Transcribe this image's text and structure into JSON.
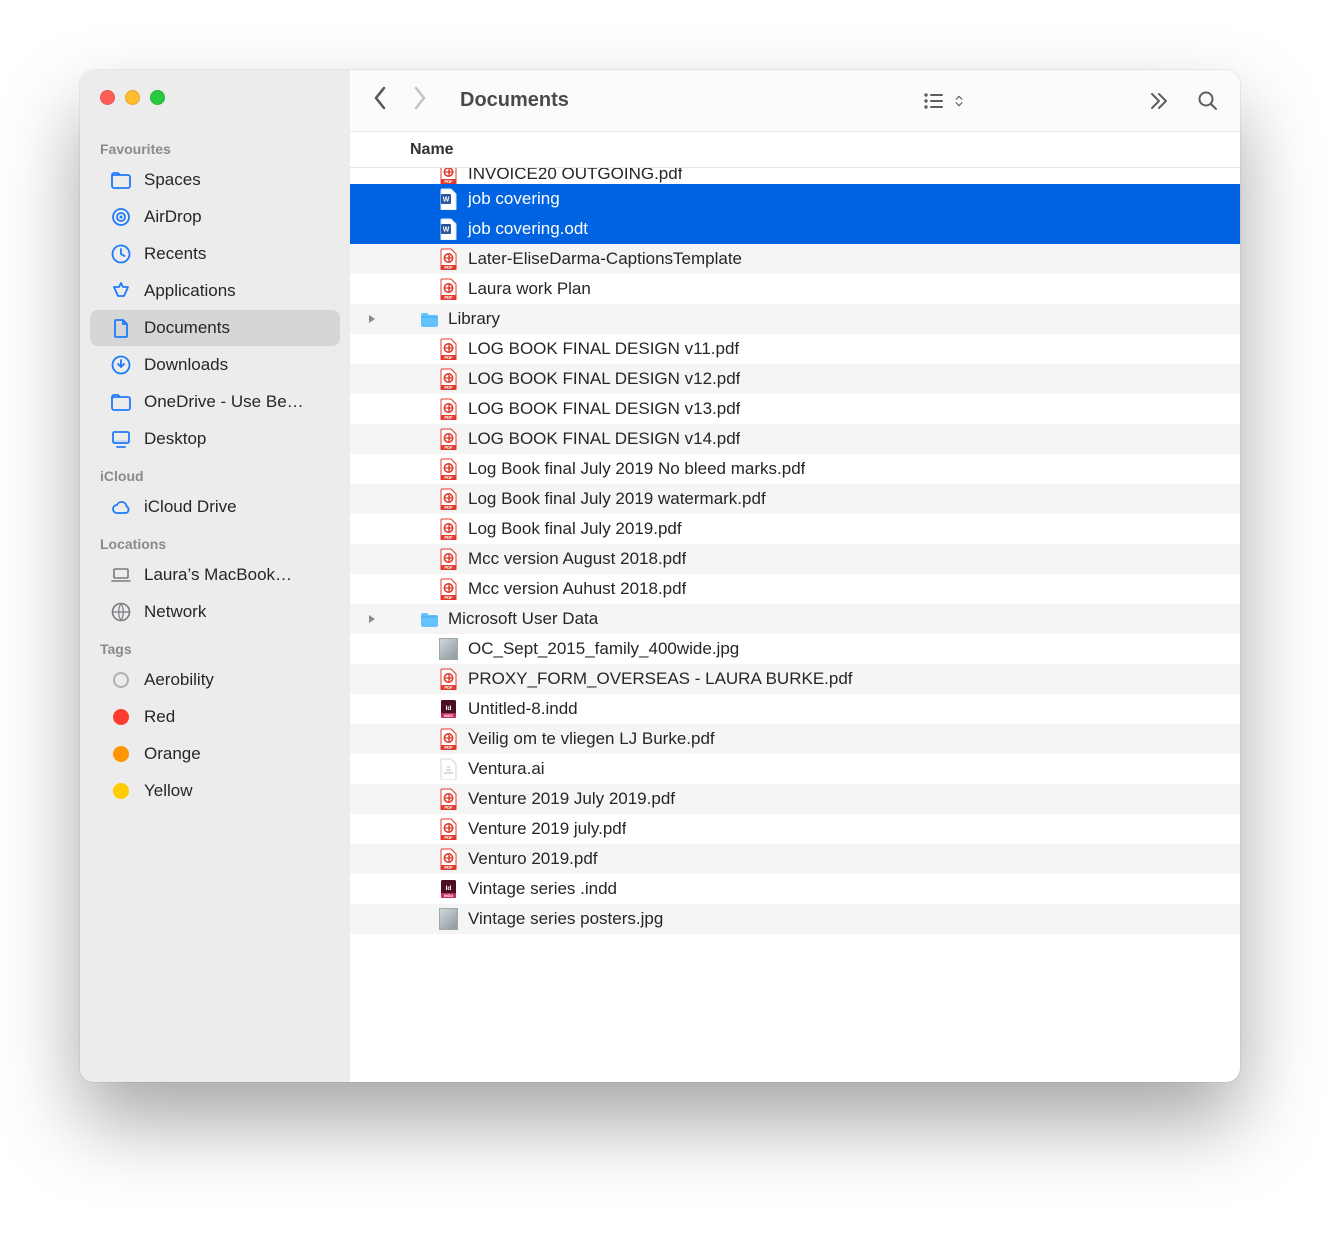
{
  "window": {
    "title": "Documents"
  },
  "columns": {
    "name": "Name"
  },
  "traffic": {
    "close": "close",
    "minimize": "minimize",
    "zoom": "zoom"
  },
  "sidebar": {
    "sections": [
      {
        "label": "Favourites",
        "items": [
          {
            "label": "Spaces",
            "icon": "folder",
            "active": false
          },
          {
            "label": "AirDrop",
            "icon": "airdrop",
            "active": false
          },
          {
            "label": "Recents",
            "icon": "clock",
            "active": false
          },
          {
            "label": "Applications",
            "icon": "appstore",
            "active": false
          },
          {
            "label": "Documents",
            "icon": "doc",
            "active": true
          },
          {
            "label": "Downloads",
            "icon": "download",
            "active": false
          },
          {
            "label": "OneDrive - Use Be…",
            "icon": "folder",
            "active": false
          },
          {
            "label": "Desktop",
            "icon": "desktop",
            "active": false
          }
        ]
      },
      {
        "label": "iCloud",
        "items": [
          {
            "label": "iCloud Drive",
            "icon": "cloud",
            "active": false
          }
        ]
      },
      {
        "label": "Locations",
        "items": [
          {
            "label": "Laura’s MacBook…",
            "icon": "laptop",
            "active": false
          },
          {
            "label": "Network",
            "icon": "globe",
            "active": false
          }
        ]
      },
      {
        "label": "Tags",
        "items": [
          {
            "label": "Aerobility",
            "icon": "tag",
            "tag_color": "outline"
          },
          {
            "label": "Red",
            "icon": "tag",
            "tag_color": "#ff3b30"
          },
          {
            "label": "Orange",
            "icon": "tag",
            "tag_color": "#ff9500"
          },
          {
            "label": "Yellow",
            "icon": "tag",
            "tag_color": "#ffcc00"
          }
        ]
      }
    ]
  },
  "files": [
    {
      "name": "INVOICE20 OUTGOING.pdf",
      "type": "pdf",
      "selected": false,
      "folder": false,
      "cut": true
    },
    {
      "name": "job covering",
      "type": "word",
      "selected": true,
      "folder": false
    },
    {
      "name": "job covering.odt",
      "type": "word",
      "selected": true,
      "folder": false
    },
    {
      "name": "Later-EliseDarma-CaptionsTemplate",
      "type": "pdf",
      "selected": false,
      "folder": false
    },
    {
      "name": "Laura work Plan",
      "type": "pdf",
      "selected": false,
      "folder": false
    },
    {
      "name": "Library",
      "type": "folder",
      "selected": false,
      "folder": true
    },
    {
      "name": "LOG BOOK FINAL DESIGN v11.pdf",
      "type": "pdf",
      "selected": false,
      "folder": false
    },
    {
      "name": "LOG BOOK FINAL DESIGN v12.pdf",
      "type": "pdf",
      "selected": false,
      "folder": false
    },
    {
      "name": "LOG BOOK FINAL DESIGN v13.pdf",
      "type": "pdf",
      "selected": false,
      "folder": false
    },
    {
      "name": "LOG BOOK FINAL DESIGN v14.pdf",
      "type": "pdf",
      "selected": false,
      "folder": false
    },
    {
      "name": "Log Book final July 2019 No bleed marks.pdf",
      "type": "pdf",
      "selected": false,
      "folder": false
    },
    {
      "name": "Log Book final July 2019 watermark.pdf",
      "type": "pdf",
      "selected": false,
      "folder": false
    },
    {
      "name": "Log Book final July 2019.pdf",
      "type": "pdf",
      "selected": false,
      "folder": false
    },
    {
      "name": "Mcc version August 2018.pdf",
      "type": "pdf",
      "selected": false,
      "folder": false
    },
    {
      "name": "Mcc version Auhust 2018.pdf",
      "type": "pdf",
      "selected": false,
      "folder": false
    },
    {
      "name": "Microsoft User Data",
      "type": "folder",
      "selected": false,
      "folder": true
    },
    {
      "name": "OC_Sept_2015_family_400wide.jpg",
      "type": "image",
      "selected": false,
      "folder": false
    },
    {
      "name": "PROXY_FORM_OVERSEAS - LAURA BURKE.pdf",
      "type": "pdf",
      "selected": false,
      "folder": false
    },
    {
      "name": "Untitled-8.indd",
      "type": "indd",
      "selected": false,
      "folder": false
    },
    {
      "name": "Veilig om te vliegen LJ Burke.pdf",
      "type": "pdf",
      "selected": false,
      "folder": false
    },
    {
      "name": "Ventura.ai",
      "type": "ai",
      "selected": false,
      "folder": false
    },
    {
      "name": "Venture 2019 July 2019.pdf",
      "type": "pdf",
      "selected": false,
      "folder": false,
      "locked": true
    },
    {
      "name": "Venture 2019 july.pdf",
      "type": "pdf",
      "selected": false,
      "folder": false
    },
    {
      "name": "Venturo 2019.pdf",
      "type": "pdf",
      "selected": false,
      "folder": false
    },
    {
      "name": "Vintage series .indd",
      "type": "indd",
      "selected": false,
      "folder": false
    },
    {
      "name": "Vintage series posters.jpg",
      "type": "image",
      "selected": false,
      "folder": false
    }
  ]
}
